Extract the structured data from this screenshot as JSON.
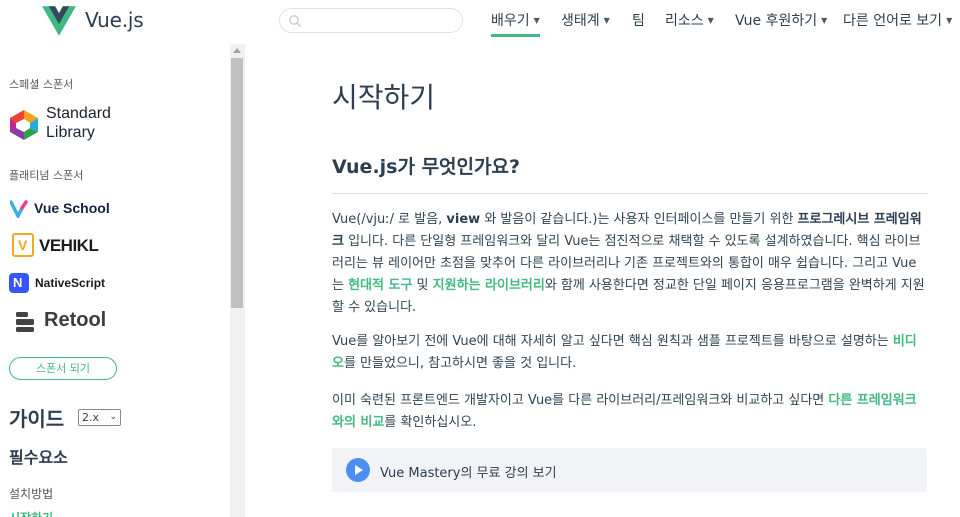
{
  "header": {
    "brand": "Vue.js",
    "search": {
      "placeholder": "",
      "value": ""
    },
    "nav": [
      {
        "label": "배우기",
        "has_dropdown": true,
        "active": true
      },
      {
        "label": "생태계",
        "has_dropdown": true
      },
      {
        "label": "팀",
        "has_dropdown": false
      },
      {
        "label": "리소스",
        "has_dropdown": true
      },
      {
        "label": "Vue 후원하기",
        "has_dropdown": true
      },
      {
        "label": "다른 언어로 보기",
        "has_dropdown": true
      }
    ],
    "caret": "▼"
  },
  "sidebar": {
    "special_sponsor_label": "스페셜 스폰서",
    "special_sponsor": {
      "line1": "Standard",
      "line2": "Library"
    },
    "platinum_sponsor_label": "플래티넘 스폰서",
    "platinum_sponsors": [
      "Vue School",
      "VEHIKL",
      "NativeScript",
      "Retool"
    ],
    "become_sponsor": "스폰서 되기",
    "guide_title": "가이드",
    "version": "2.x",
    "section_title": "필수요소",
    "links": [
      {
        "label": "설치방법",
        "active": false
      },
      {
        "label": "시작하기",
        "active": true
      }
    ]
  },
  "content": {
    "title": "시작하기",
    "subtitle": "Vue.js가 무엇인가요?",
    "para1": {
      "p1": "Vue(/vjuː/ 로 발음, ",
      "p1b": "view",
      "p2": " 와 발음이 같습니다.)는 사용자 인터페이스를 만들기 위한 ",
      "p2b": "프로그레시브 프레임워크",
      "p3": " 입니다. 다른 단일형 프레임워크와 달리 Vue는 점진적으로 채택할 수 있도록 설계하였습니다. 핵심 라이브러리는 뷰 레이어만 초점을 맞추어 다른 라이브러리나 기존 프로젝트와의 통합이 매우 쉽습니다. 그리고 Vue는 ",
      "link1": "현대적 도구",
      "p4": " 및 ",
      "link2": "지원하는 라이브러리",
      "p5": "와 함께 사용한다면 정교한 단일 페이지 응용프로그램을 완벽하게 지원할 수 있습니다."
    },
    "para2": {
      "p1": "Vue를 알아보기 전에 Vue에 대해 자세히 알고 싶다면 핵심 원칙과 샘플 프로젝트를 바탕으로 설명하는 ",
      "link1": "비디오",
      "p2": "를 만들었으니, 참고하시면 좋을 것 입니다."
    },
    "para3": {
      "p1": "이미 숙련된 프론트엔드 개발자이고 Vue를 다른 라이브러리/프레임워크와 비교하고 싶다면 ",
      "link1": "다른 프레임워크와의 비교",
      "p2": "를 확인하십시오."
    },
    "mastery": "Vue Mastery의 무료 강의 보기"
  },
  "colors": {
    "accent": "#42b983",
    "text": "#2c3e50",
    "vue_dark": "#35495e",
    "play": "#4d8ef5"
  }
}
